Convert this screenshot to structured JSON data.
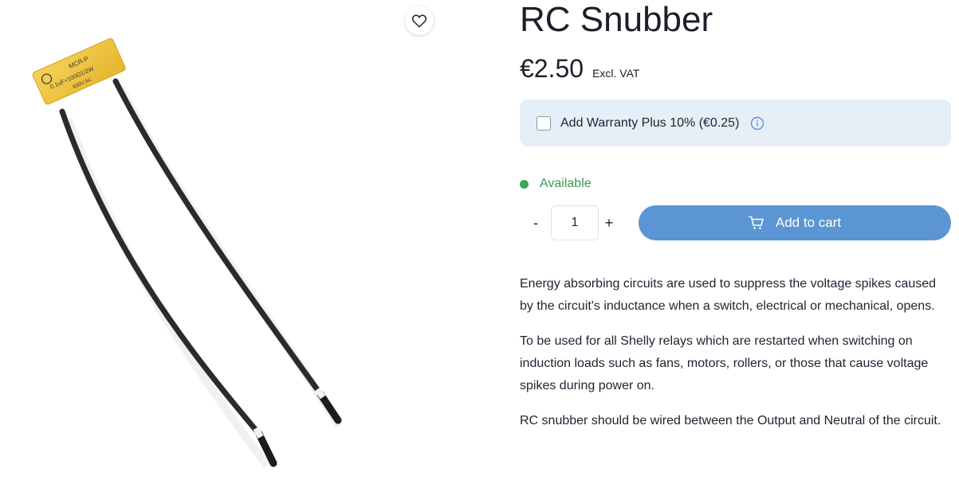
{
  "product": {
    "title": "RC Snubber",
    "price": "€2.50",
    "vat_note": "Excl. VAT",
    "image": {
      "component_text_1": "MCR-P",
      "component_text_2": "0.1uF+100Ω1/2W",
      "component_text_3": "600V AC"
    }
  },
  "warranty": {
    "label": "Add Warranty Plus 10% (€0.25)",
    "checked": false
  },
  "availability": {
    "status": "Available",
    "color": "#3aa85a"
  },
  "quantity": {
    "minus_label": "-",
    "value": "1",
    "plus_label": "+"
  },
  "cart": {
    "button_label": "Add to cart",
    "color": "#5b95d3"
  },
  "description": [
    "Energy absorbing circuits are used to suppress the voltage spikes caused by the circuit's inductance when a switch, electrical or mechanical, opens.",
    "To be used for all Shelly relays which are restarted when switching on induction loads such as fans, motors, rollers, or those that cause voltage spikes during power on.",
    "RC snubber should be wired between the Output and Neutral of the circuit."
  ],
  "icons": {
    "wishlist": "heart-icon",
    "info": "info-icon",
    "cart": "cart-icon"
  }
}
